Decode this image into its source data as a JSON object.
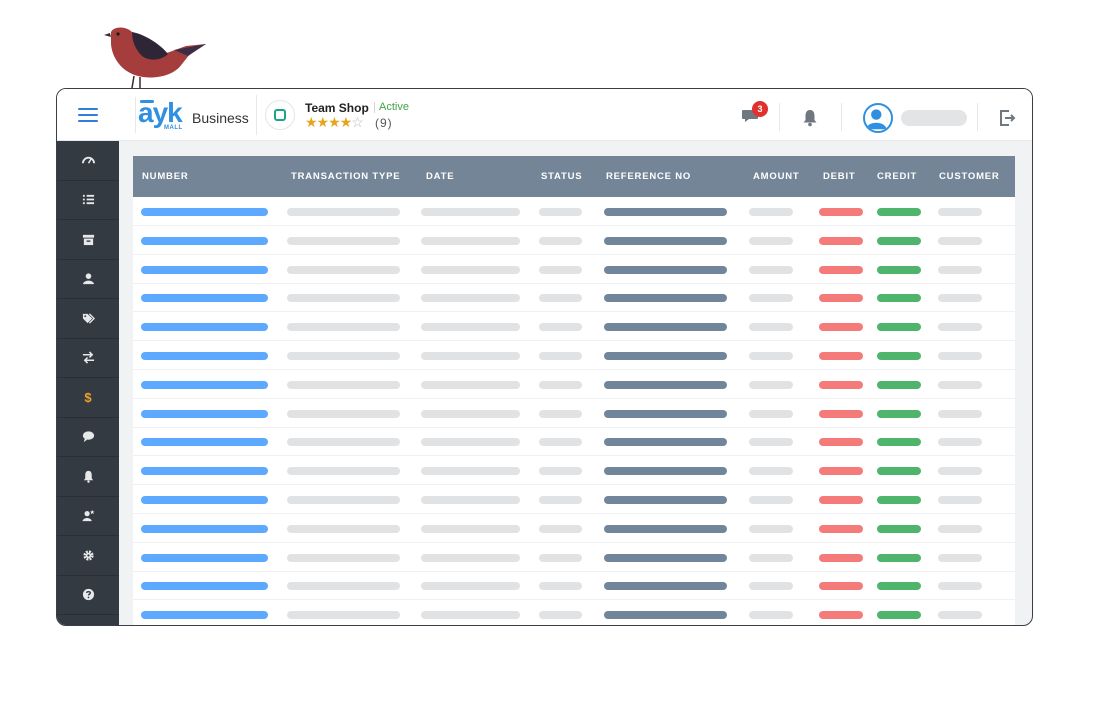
{
  "brand": {
    "logo_text": "ayk",
    "logo_sub": "MALL",
    "product": "Business",
    "color": "#2f8fe0"
  },
  "shop": {
    "name": "Team Shop",
    "status": "Active",
    "stars_filled": 4,
    "stars_total": 5,
    "review_count": "(9)"
  },
  "header": {
    "chat_badge": "3"
  },
  "sidebar": {
    "items": [
      {
        "icon": "dashboard-icon"
      },
      {
        "icon": "list-icon"
      },
      {
        "icon": "archive-icon"
      },
      {
        "icon": "user-icon"
      },
      {
        "icon": "tags-icon"
      },
      {
        "icon": "exchange-icon"
      },
      {
        "icon": "dollar-icon",
        "label": "$",
        "color": "#f0a02c"
      },
      {
        "icon": "comment-icon"
      },
      {
        "icon": "bell-icon"
      },
      {
        "icon": "user-star-icon"
      },
      {
        "icon": "gear-icon"
      },
      {
        "icon": "help-icon"
      }
    ]
  },
  "table": {
    "columns": [
      "NUMBER",
      "TRANSACTION TYPE",
      "DATE",
      "STATUS",
      "REFERENCE NO",
      "AMOUNT",
      "DEBIT",
      "CREDIT",
      "CUSTOMER"
    ],
    "row_count": 15,
    "colors": {
      "number": "#5ca9ff",
      "placeholder": "#e1e2e4",
      "reference": "#72869b",
      "debit": "#f57a7a",
      "credit": "#4fb46c",
      "header_bg": "#738597"
    }
  }
}
